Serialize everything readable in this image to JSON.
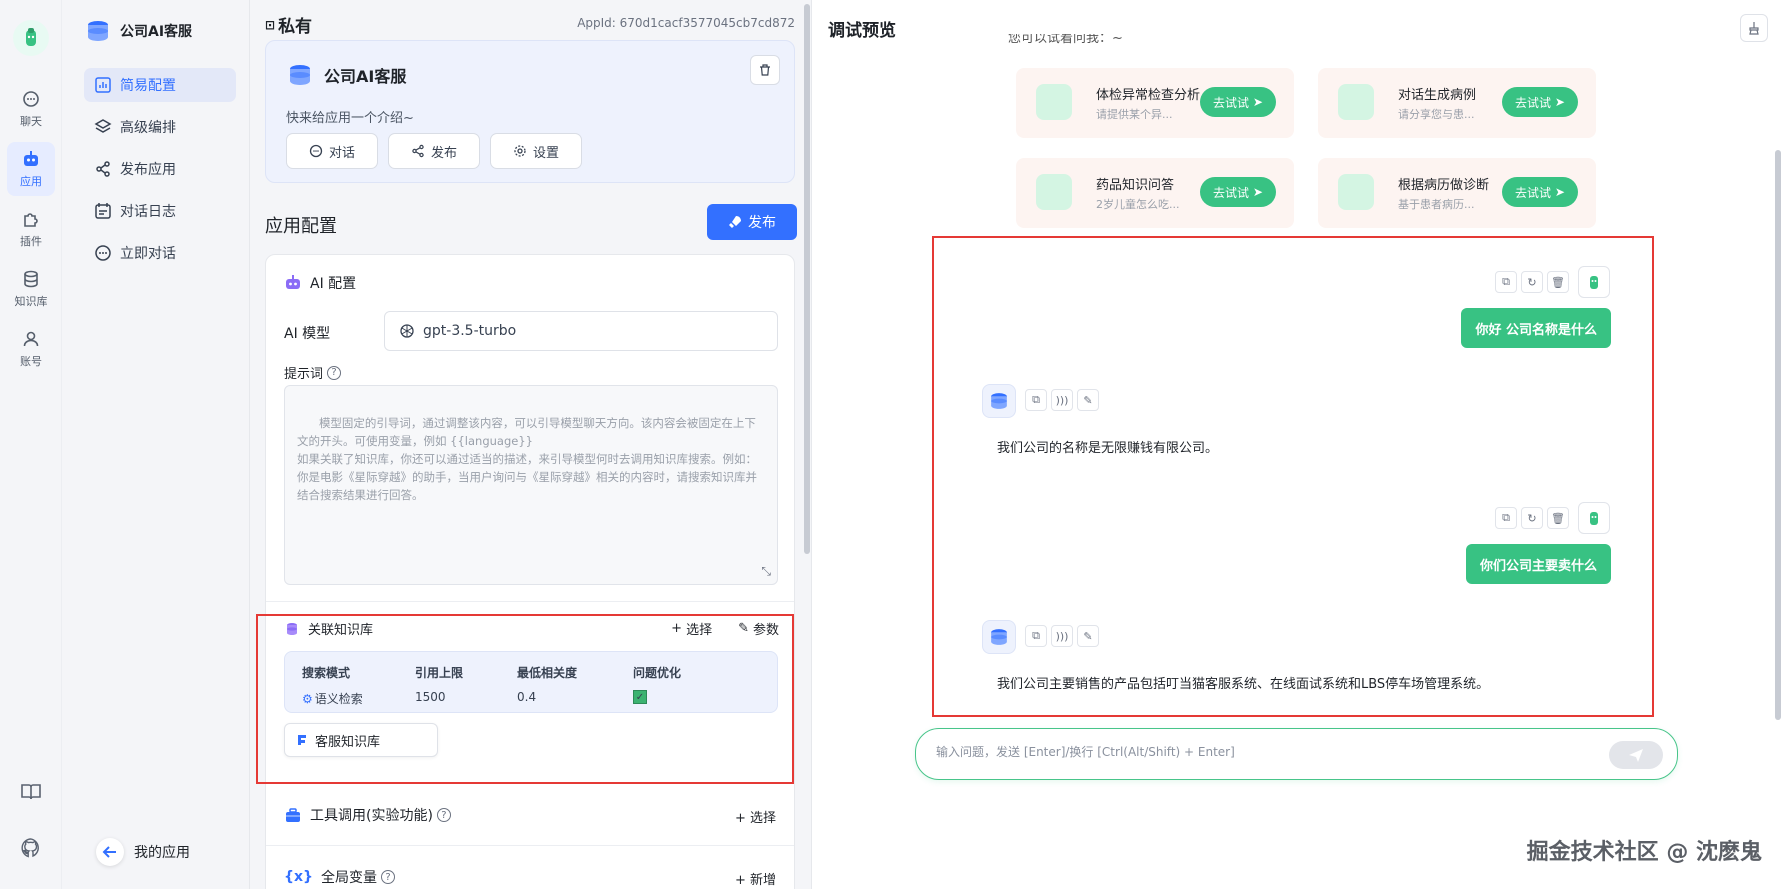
{
  "rail": {
    "items": [
      {
        "label": "聊天"
      },
      {
        "label": "应用"
      },
      {
        "label": "插件"
      },
      {
        "label": "知识库"
      },
      {
        "label": "账号"
      }
    ]
  },
  "nav": {
    "app_title": "公司AI客服",
    "items": [
      {
        "label": "简易配置"
      },
      {
        "label": "高级编排"
      },
      {
        "label": "发布应用"
      },
      {
        "label": "对话日志"
      },
      {
        "label": "立即对话"
      }
    ],
    "back_label": "我的应用"
  },
  "config": {
    "private_label": "私有",
    "app_id": "AppId: 670d1cacf3577045cb7cd872",
    "app_name": "公司AI客服",
    "intro": "快来给应用一个介绍~",
    "buttons": {
      "chat": "对话",
      "publish": "发布",
      "settings": "设置"
    },
    "section_title": "应用配置",
    "publish_btn": "发布",
    "ai_config_title": "AI 配置",
    "model_label": "AI 模型",
    "model_value": "gpt-3.5-turbo",
    "prompt_label": "提示词",
    "prompt_placeholder": "模型固定的引导词，通过调整该内容，可以引导模型聊天方向。该内容会被固定在上下文的开头。可使用变量，例如 {{language}}\n如果关联了知识库，你还可以通过适当的描述，来引导模型何时去调用知识库搜索。例如：\n你是电影《星际穿越》的助手，当用户询问与《星际穿越》相关的内容时，请搜索知识库并结合搜索结果进行回答。",
    "kb": {
      "title": "关联知识库",
      "select": "选择",
      "params": "参数",
      "headers": [
        "搜索模式",
        "引用上限",
        "最低相关度",
        "问题优化"
      ],
      "row": {
        "mode": "语义检索",
        "limit": "1500",
        "min_relevance": "0.4",
        "optimize": true
      },
      "chip": "客服知识库"
    },
    "tools": {
      "title": "工具调用(实验功能)",
      "action": "选择"
    },
    "vars": {
      "title": "全局变量",
      "action": "新增"
    }
  },
  "preview": {
    "title": "调试预览",
    "cut_text": "您可以试着问我：~",
    "suggestions": [
      {
        "title": "体检异常检查分析",
        "sub": "请提供某个异...",
        "go": "去试试"
      },
      {
        "title": "对话生成病例",
        "sub": "请分享您与患...",
        "go": "去试试"
      },
      {
        "title": "药品知识问答",
        "sub": "2岁儿童怎么吃...",
        "go": "去试试"
      },
      {
        "title": "根据病历做诊断",
        "sub": "基于患者病历...",
        "go": "去试试"
      }
    ],
    "messages": [
      {
        "role": "user",
        "text": "你好 公司名称是什么"
      },
      {
        "role": "ai",
        "text": "我们公司的名称是无限赚钱有限公司。"
      },
      {
        "role": "user",
        "text": "你们公司主要卖什么"
      },
      {
        "role": "ai",
        "text": "我们公司主要销售的产品包括叮当猫客服系统、在线面试系统和LBS停车场管理系统。"
      }
    ],
    "input_placeholder": "输入问题，发送 [Enter]/换行 [Ctrl(Alt/Shift) + Enter]"
  },
  "watermark": "掘金技术社区 @ 沈麽鬼",
  "colors": {
    "accent": "#3370ff",
    "green": "#38c283",
    "highlight": "#e53935"
  }
}
